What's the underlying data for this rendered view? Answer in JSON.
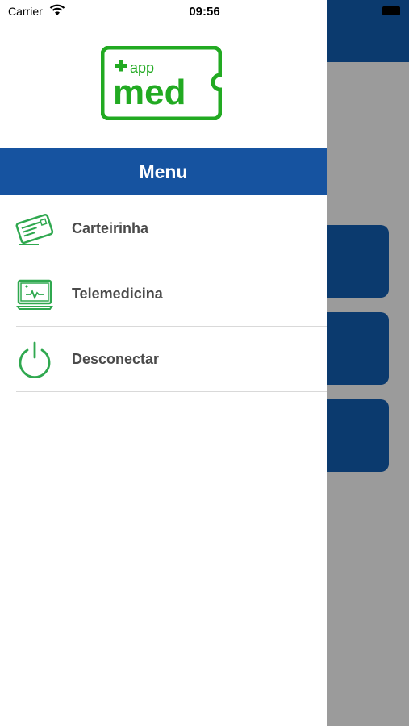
{
  "status_bar": {
    "carrier": "Carrier",
    "time": "09:56"
  },
  "logo": {
    "plus": "+",
    "app": "app",
    "med": "med"
  },
  "menu": {
    "title": "Menu",
    "items": [
      {
        "label": "Carteirinha",
        "icon": "id-card-icon"
      },
      {
        "label": "Telemedicina",
        "icon": "monitor-heartbeat-icon"
      },
      {
        "label": "Desconectar",
        "icon": "power-icon"
      }
    ]
  },
  "colors": {
    "brand_green": "#22aa22",
    "menu_header_blue": "#1653a0",
    "background_dark_blue": "#0b3a6e",
    "overlay_gray": "#9b9b9b"
  }
}
